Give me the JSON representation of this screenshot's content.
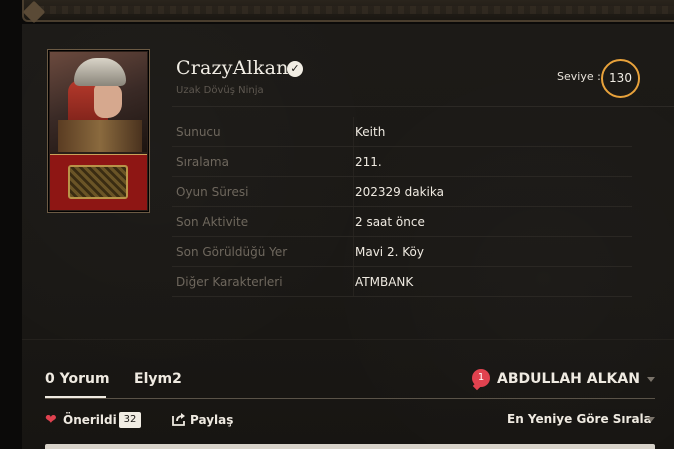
{
  "profile": {
    "name": "CrazyAlkan",
    "class": "Uzak Dövüş Ninja",
    "level_label": "Seviye :",
    "level": "130"
  },
  "info": [
    {
      "label": "Sunucu",
      "value": "Keith"
    },
    {
      "label": "Sıralama",
      "value": "211."
    },
    {
      "label": "Oyun Süresi",
      "value": "202329 dakika"
    },
    {
      "label": "Son Aktivite",
      "value": "2 saat önce"
    },
    {
      "label": "Son Görüldüğü Yer",
      "value": "Mavi 2. Köy"
    },
    {
      "label": "Diğer Karakterleri",
      "value": "ATMBANK"
    }
  ],
  "comments": {
    "tabs": [
      "0 Yorum",
      "Elym2"
    ],
    "notification_count": "1",
    "user": "ABDULLAH ALKAN",
    "recommend_label": "Önerildi",
    "recommend_count": "32",
    "share_label": "Paylaş",
    "sort_label": "En Yeniye Göre Sırala"
  },
  "icons": {
    "verified": "verified-check-icon",
    "heart": "heart-icon",
    "share": "share-icon",
    "caret": "chevron-down-icon"
  },
  "colors": {
    "level_ring": "#e8a23b",
    "badge": "#e0424f",
    "background": "#1a1815"
  }
}
